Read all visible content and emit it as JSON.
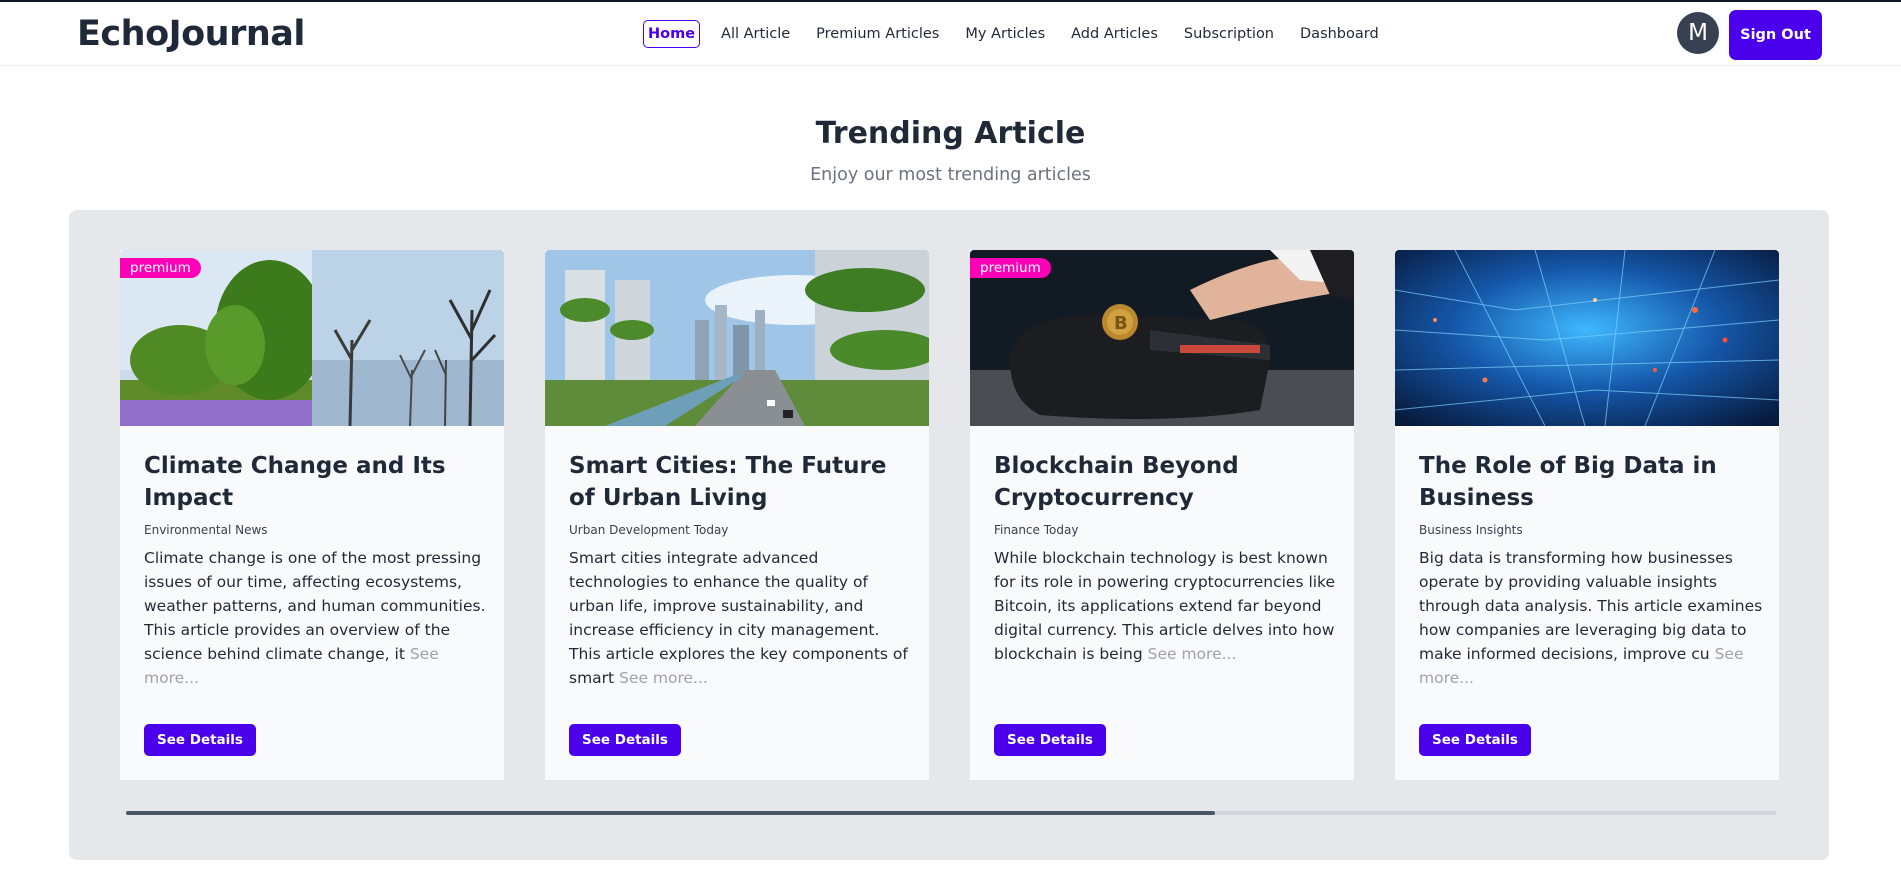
{
  "app": {
    "logo": "EchoJournal"
  },
  "nav": {
    "items": [
      {
        "label": "Home",
        "active": true
      },
      {
        "label": "All Article",
        "active": false
      },
      {
        "label": "Premium Articles",
        "active": false
      },
      {
        "label": "My Articles",
        "active": false
      },
      {
        "label": "Add Articles",
        "active": false
      },
      {
        "label": "Subscription",
        "active": false
      },
      {
        "label": "Dashboard",
        "active": false
      }
    ],
    "avatar_initial": "M",
    "signout_label": "Sign Out"
  },
  "section": {
    "title": "Trending Article",
    "subtitle": "Enjoy our most trending articles"
  },
  "cards": [
    {
      "premium_label": "premium",
      "title": "Climate Change and Its Impact",
      "source": "Environmental News",
      "description": "Climate change is one of the most pressing issues of our time, affecting ecosystems, weather patterns, and human communities. This article provides an overview of the science behind climate change, it",
      "see_more": "See more...",
      "button": "See Details",
      "image": "forest-and-flooded-trees-image"
    },
    {
      "premium_label": "",
      "title": "Smart Cities: The Future of Urban Living",
      "source": "Urban Development Today",
      "description": "Smart cities integrate advanced technologies to enhance the quality of urban life, improve sustainability, and increase efficiency in city management. This article explores the key components of smart",
      "see_more": "See more...",
      "button": "See Details",
      "image": "green-city-skyline-image"
    },
    {
      "premium_label": "premium",
      "title": "Blockchain Beyond Cryptocurrency",
      "source": "Finance Today",
      "description": "While blockchain technology is best known for its role in powering cryptocurrencies like Bitcoin, its applications extend far beyond digital currency. This article delves into how blockchain is being",
      "see_more": "See more...",
      "button": "See Details",
      "image": "bitcoin-payment-terminal-image"
    },
    {
      "premium_label": "",
      "title": "The Role of Big Data in Business",
      "source": "Business Insights",
      "description": "Big data is transforming how businesses operate by providing valuable insights through data analysis. This article examines how companies are leveraging big data to make informed decisions, improve cu",
      "see_more": "See more...",
      "button": "See Details",
      "image": "circuit-data-network-image"
    }
  ],
  "scroll": {
    "position_fraction": 0.66
  },
  "colors": {
    "accent": "#4a00ea",
    "premium_badge": "#ff00b8",
    "carousel_bg": "#e5e7eb",
    "card_bg": "#f9fafb"
  }
}
